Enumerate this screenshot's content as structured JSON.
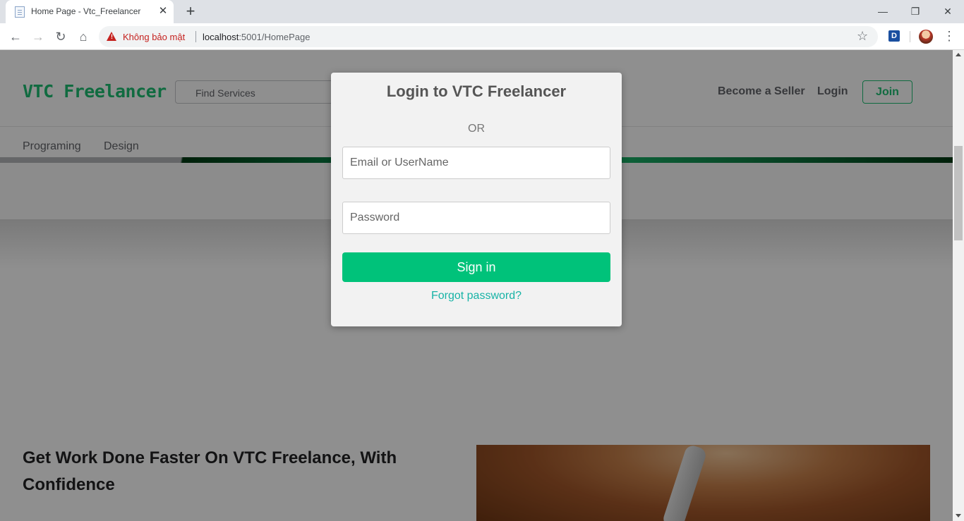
{
  "browser": {
    "tab_title": "Home Page - Vtc_Freelancer",
    "tab_close": "✕",
    "new_tab": "+",
    "window_controls": {
      "minimize": "—",
      "restore": "❐",
      "close": "✕"
    },
    "nav": {
      "back": "←",
      "forward": "→",
      "reload": "↻",
      "home": "⌂"
    },
    "security_label": "Không bảo mật",
    "url_host": "localhost",
    "url_path": ":5001/HomePage",
    "bookmark_star": "☆",
    "extension_badge": "D",
    "menu": "⋮"
  },
  "site": {
    "logo": "VTC Freelancer",
    "search_placeholder": "Find Services",
    "nav_links": {
      "become_seller": "Become a Seller",
      "login": "Login",
      "join": "Join"
    },
    "categories": [
      "Programing",
      "Design"
    ],
    "promo_title": "Get Work Done Faster On VTC Freelance, With Confidence"
  },
  "modal": {
    "title": "Login to VTC Freelancer",
    "or_text": "OR",
    "email_placeholder": "Email or UserName",
    "password_placeholder": "Password",
    "signin_label": "Sign in",
    "forgot_label": "Forgot password?"
  },
  "colors": {
    "brand_green": "#1dbf73",
    "signin_green": "#00c27a",
    "link_teal": "#17b3a6",
    "insecure_red": "#c5221f"
  }
}
